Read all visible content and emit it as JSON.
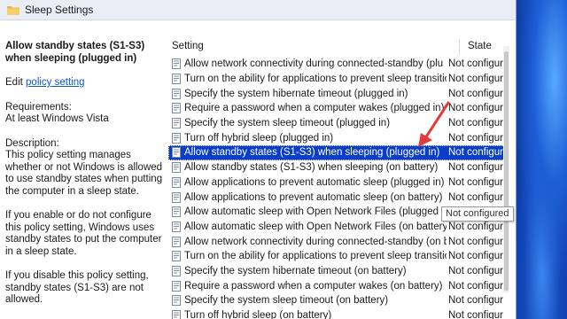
{
  "window": {
    "title": "Sleep Settings"
  },
  "description": {
    "policy_title": "Allow standby states (S1-S3) when sleeping (plugged in)",
    "edit_prefix": "Edit",
    "edit_link": "policy setting",
    "requirements_label": "Requirements:",
    "requirements_value": "At least Windows Vista",
    "description_label": "Description:",
    "description_text": "This policy setting manages whether or not Windows is allowed to use standby states when putting the computer in a sleep state.",
    "enable_text": "If you enable or do not configure this policy setting, Windows uses standby states to put the computer in a sleep state.",
    "disable_text": "If you disable this policy setting, standby states (S1-S3) are not allowed."
  },
  "list": {
    "columns": {
      "setting": "Setting",
      "state": "State"
    },
    "rows": [
      {
        "name": "Allow network connectivity during connected-standby (plu",
        "state": "Not configur"
      },
      {
        "name": "Turn on the ability for applications to prevent sleep transitio",
        "state": "Not configur"
      },
      {
        "name": "Specify the system hibernate timeout (plugged in)",
        "state": "Not configur"
      },
      {
        "name": "Require a password when a computer wakes (plugged in)",
        "state": "Not configur"
      },
      {
        "name": "Specify the system sleep timeout (plugged in)",
        "state": "Not configur"
      },
      {
        "name": "Turn off hybrid sleep (plugged in)",
        "state": "Not configur"
      },
      {
        "name": "Allow standby states (S1-S3) when sleeping (plugged in)",
        "state": "Not configur"
      },
      {
        "name": "Allow standby states (S1-S3) when sleeping (on battery)",
        "state": "Not configur"
      },
      {
        "name": "Allow applications to prevent automatic sleep (plugged in)",
        "state": "Not configur"
      },
      {
        "name": "Allow applications to prevent automatic sleep (on battery)",
        "state": "Not configur"
      },
      {
        "name": "Allow automatic sleep with Open Network Files (plugged in)",
        "state": "Not configur"
      },
      {
        "name": "Allow automatic sleep with Open Network Files (on battery)",
        "state": "Not configur"
      },
      {
        "name": "Allow network connectivity during connected-standby (on ba",
        "state": "Not configur"
      },
      {
        "name": "Turn on the ability for applications to prevent sleep transitio",
        "state": "Not configur"
      },
      {
        "name": "Specify the system hibernate timeout (on battery)",
        "state": "Not configur"
      },
      {
        "name": "Require a password when a computer wakes (on battery)",
        "state": "Not configur"
      },
      {
        "name": "Specify the system sleep timeout (on battery)",
        "state": "Not configur"
      },
      {
        "name": "Turn off hybrid sleep (on battery)",
        "state": "Not configur"
      }
    ],
    "selected_index": 6
  },
  "tooltip": {
    "text": "Not configured"
  },
  "colors": {
    "selection": "#0a3ec9",
    "arrow": "#e23b3b",
    "link": "#0a58c8"
  }
}
